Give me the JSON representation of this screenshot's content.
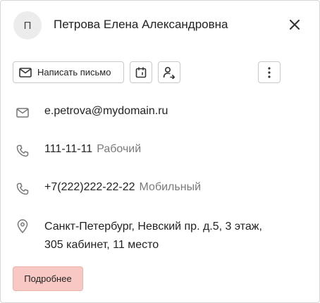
{
  "contact": {
    "avatar_initial": "П",
    "full_name": "Петрова Елена Александровна"
  },
  "toolbar": {
    "write_label": "Написать письмо"
  },
  "details": {
    "email": "e.petrova@mydomain.ru",
    "phone_work": {
      "number": "111-11-11",
      "type": "Рабочий"
    },
    "phone_mobile": {
      "number": "+7(222)222-22-22",
      "type": "Мобильный"
    },
    "address": "Санкт-Петербург, Невский пр. д.5, 3 этаж, 305 кабинет, 11 место"
  },
  "actions": {
    "details_label": "Подробнее"
  },
  "icons": {
    "close": "close-icon",
    "mail": "mail-icon",
    "calendar": "calendar-icon",
    "forward_user": "user-forward-icon",
    "more": "more-vertical-icon",
    "phone": "phone-icon",
    "location": "location-pin-icon"
  },
  "colors": {
    "accent_button_bg": "#f8c9c4",
    "avatar_bg": "#ececec",
    "secondary_text": "#7a7a7a"
  }
}
